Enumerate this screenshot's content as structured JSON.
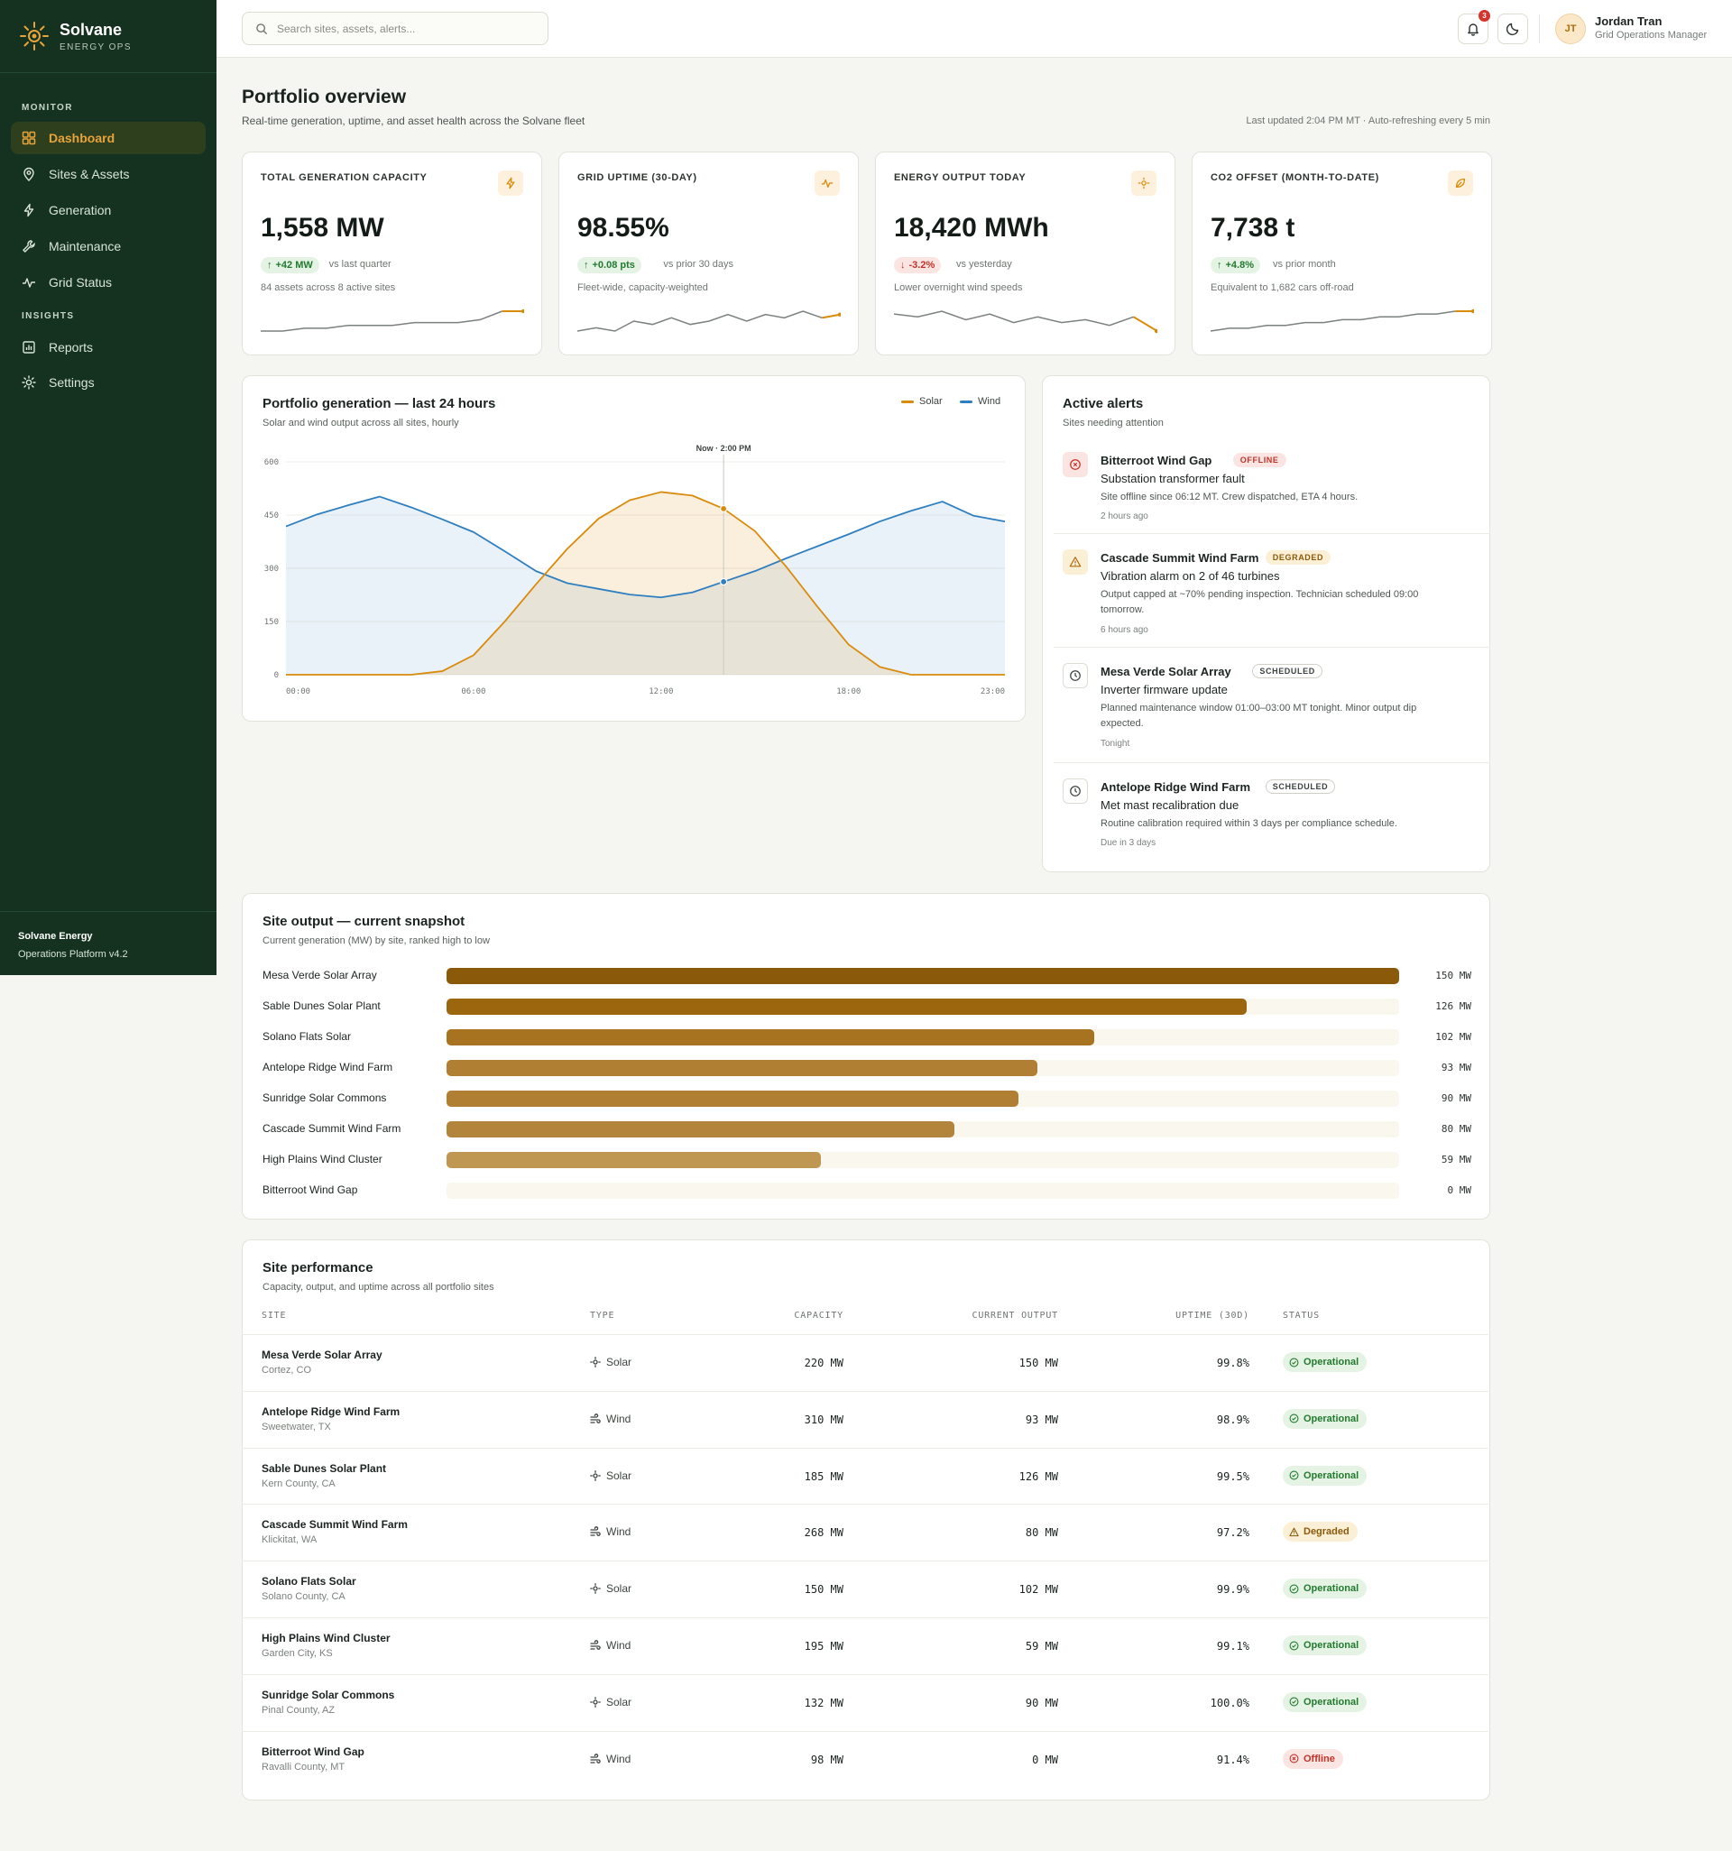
{
  "brand": {
    "name": "Solvane",
    "tagline": "ENERGY OPS"
  },
  "sidebar": {
    "sections": [
      {
        "title": "MONITOR",
        "items": [
          {
            "label": "Dashboard",
            "icon": "grid-icon",
            "active": true
          },
          {
            "label": "Sites & Assets",
            "icon": "map-pin-icon"
          },
          {
            "label": "Generation",
            "icon": "bolt-icon"
          },
          {
            "label": "Maintenance",
            "icon": "wrench-icon"
          },
          {
            "label": "Grid Status",
            "icon": "pulse-icon"
          }
        ]
      },
      {
        "title": "INSIGHTS",
        "items": [
          {
            "label": "Reports",
            "icon": "report-icon"
          },
          {
            "label": "Settings",
            "icon": "gear-icon"
          }
        ]
      }
    ],
    "footer": {
      "company": "Solvane Energy",
      "version": "Operations Platform v4.2"
    }
  },
  "header": {
    "search_placeholder": "Search sites, assets, alerts...",
    "notification_count": "3",
    "user": {
      "initials": "JT",
      "name": "Jordan Tran",
      "role": "Grid Operations Manager"
    }
  },
  "page": {
    "title": "Portfolio overview",
    "subtitle": "Real-time generation, uptime, and asset health across the Solvane fleet",
    "updated": "Last updated 2:04 PM MT · Auto-refreshing every 5 min"
  },
  "kpis": [
    {
      "label": "TOTAL GENERATION CAPACITY",
      "icon": "bolt-icon",
      "value": "1,558 MW",
      "delta": "+42 MW",
      "direction": "up",
      "compare": "vs last quarter",
      "note": "84 assets across 8 active sites",
      "spark": [
        1,
        1,
        2,
        2,
        3,
        3,
        3,
        4,
        4,
        4,
        5,
        8,
        8
      ]
    },
    {
      "label": "GRID UPTIME (30-DAY)",
      "icon": "pulse-icon",
      "value": "98.55%",
      "delta": "+0.08 pts",
      "direction": "up",
      "compare": "vs prior 30 days",
      "note": "Fleet-wide, capacity-weighted",
      "spark": [
        3,
        4,
        3,
        6,
        5,
        7,
        5,
        6,
        8,
        6,
        8,
        7,
        9,
        7,
        8
      ]
    },
    {
      "label": "ENERGY OUTPUT TODAY",
      "icon": "sun-icon",
      "value": "18,420 MWh",
      "delta": "-3.2%",
      "direction": "down",
      "compare": "vs yesterday",
      "note": "Lower overnight wind speeds",
      "spark": [
        8,
        7,
        9,
        6,
        8,
        5,
        7,
        5,
        6,
        4,
        7,
        2
      ]
    },
    {
      "label": "CO2 OFFSET (MONTH-TO-DATE)",
      "icon": "leaf-icon",
      "value": "7,738 t",
      "delta": "+4.8%",
      "direction": "up",
      "compare": "vs prior month",
      "note": "Equivalent to 1,682 cars off-road",
      "spark": [
        1,
        2,
        2,
        3,
        3,
        4,
        4,
        5,
        5,
        6,
        6,
        7,
        7,
        8,
        8
      ]
    }
  ],
  "colors": {
    "solar": "#d98b0c",
    "wind": "#2f7fc0",
    "accent": "#e8a33b"
  },
  "generation_chart": {
    "title": "Portfolio generation — last 24 hours",
    "subtitle": "Solar and wind output across all sites, hourly",
    "now_label": "Now · 2:00 PM",
    "chart_data": {
      "type": "area",
      "x": [
        "00:00",
        "01:00",
        "02:00",
        "03:00",
        "04:00",
        "05:00",
        "06:00",
        "07:00",
        "08:00",
        "09:00",
        "10:00",
        "11:00",
        "12:00",
        "13:00",
        "14:00",
        "15:00",
        "16:00",
        "17:00",
        "18:00",
        "19:00",
        "20:00",
        "21:00",
        "22:00",
        "23:00"
      ],
      "x_ticks": [
        "00:00",
        "06:00",
        "12:00",
        "18:00",
        "23:00"
      ],
      "y_ticks": [
        0,
        150,
        300,
        450,
        600
      ],
      "ylim": [
        0,
        600
      ],
      "now_index": 14,
      "series": [
        {
          "name": "Solar",
          "values": [
            0,
            0,
            0,
            0,
            0,
            10,
            55,
            150,
            255,
            355,
            440,
            492,
            515,
            505,
            468,
            405,
            305,
            192,
            85,
            22,
            0,
            0,
            0,
            0
          ]
        },
        {
          "name": "Wind",
          "values": [
            418,
            452,
            478,
            502,
            472,
            438,
            402,
            348,
            292,
            258,
            242,
            226,
            218,
            232,
            262,
            292,
            328,
            362,
            396,
            432,
            462,
            488,
            448,
            432
          ]
        }
      ]
    }
  },
  "alerts": {
    "title": "Active alerts",
    "subtitle": "Sites needing attention",
    "items": [
      {
        "site": "Bitterroot Wind Gap",
        "badge": "OFFLINE",
        "kind": "offline",
        "issue": "Substation transformer fault",
        "desc": "Site offline since 06:12 MT. Crew dispatched, ETA 4 hours.",
        "time": "2 hours ago"
      },
      {
        "site": "Cascade Summit Wind Farm",
        "badge": "DEGRADED",
        "kind": "degraded",
        "issue": "Vibration alarm on 2 of 46 turbines",
        "desc": "Output capped at ~70% pending inspection. Technician scheduled 09:00 tomorrow.",
        "time": "6 hours ago"
      },
      {
        "site": "Mesa Verde Solar Array",
        "badge": "SCHEDULED",
        "kind": "scheduled",
        "issue": "Inverter firmware update",
        "desc": "Planned maintenance window 01:00–03:00 MT tonight. Minor output dip expected.",
        "time": "Tonight"
      },
      {
        "site": "Antelope Ridge Wind Farm",
        "badge": "SCHEDULED",
        "kind": "scheduled",
        "issue": "Met mast recalibration due",
        "desc": "Routine calibration required within 3 days per compliance schedule.",
        "time": "Due in 3 days"
      }
    ]
  },
  "site_output": {
    "title": "Site output — current snapshot",
    "subtitle": "Current generation (MW) by site, ranked high to low",
    "chart_data": {
      "type": "bar",
      "orientation": "horizontal",
      "xlim": [
        0,
        150
      ],
      "categories": [
        "Mesa Verde Solar Array",
        "Sable Dunes Solar Plant",
        "Solano Flats Solar",
        "Antelope Ridge Wind Farm",
        "Sunridge Solar Commons",
        "Cascade Summit Wind Farm",
        "High Plains Wind Cluster",
        "Bitterroot Wind Gap"
      ],
      "values": [
        150,
        126,
        102,
        93,
        90,
        80,
        59,
        0
      ],
      "labels": [
        "150 MW",
        "126 MW",
        "102 MW",
        "93 MW",
        "90 MW",
        "80 MW",
        "59 MW",
        "0 MW"
      ]
    }
  },
  "performance": {
    "title": "Site performance",
    "subtitle": "Capacity, output, and uptime across all portfolio sites",
    "columns": [
      "SITE",
      "TYPE",
      "CAPACITY",
      "CURRENT OUTPUT",
      "UPTIME (30D)",
      "STATUS"
    ],
    "rows": [
      {
        "site": "Mesa Verde Solar Array",
        "location": "Cortez, CO",
        "type": "Solar",
        "capacity": "220 MW",
        "output": "150 MW",
        "uptime": "99.8%",
        "status": "Operational",
        "kind": "op"
      },
      {
        "site": "Antelope Ridge Wind Farm",
        "location": "Sweetwater, TX",
        "type": "Wind",
        "capacity": "310 MW",
        "output": "93 MW",
        "uptime": "98.9%",
        "status": "Operational",
        "kind": "op"
      },
      {
        "site": "Sable Dunes Solar Plant",
        "location": "Kern County, CA",
        "type": "Solar",
        "capacity": "185 MW",
        "output": "126 MW",
        "uptime": "99.5%",
        "status": "Operational",
        "kind": "op"
      },
      {
        "site": "Cascade Summit Wind Farm",
        "location": "Klickitat, WA",
        "type": "Wind",
        "capacity": "268 MW",
        "output": "80 MW",
        "uptime": "97.2%",
        "status": "Degraded",
        "kind": "dg"
      },
      {
        "site": "Solano Flats Solar",
        "location": "Solano County, CA",
        "type": "Solar",
        "capacity": "150 MW",
        "output": "102 MW",
        "uptime": "99.9%",
        "status": "Operational",
        "kind": "op"
      },
      {
        "site": "High Plains Wind Cluster",
        "location": "Garden City, KS",
        "type": "Wind",
        "capacity": "195 MW",
        "output": "59 MW",
        "uptime": "99.1%",
        "status": "Operational",
        "kind": "op"
      },
      {
        "site": "Sunridge Solar Commons",
        "location": "Pinal County, AZ",
        "type": "Solar",
        "capacity": "132 MW",
        "output": "90 MW",
        "uptime": "100.0%",
        "status": "Operational",
        "kind": "op"
      },
      {
        "site": "Bitterroot Wind Gap",
        "location": "Ravalli County, MT",
        "type": "Wind",
        "capacity": "98 MW",
        "output": "0 MW",
        "uptime": "91.4%",
        "status": "Offline",
        "kind": "off"
      }
    ]
  }
}
